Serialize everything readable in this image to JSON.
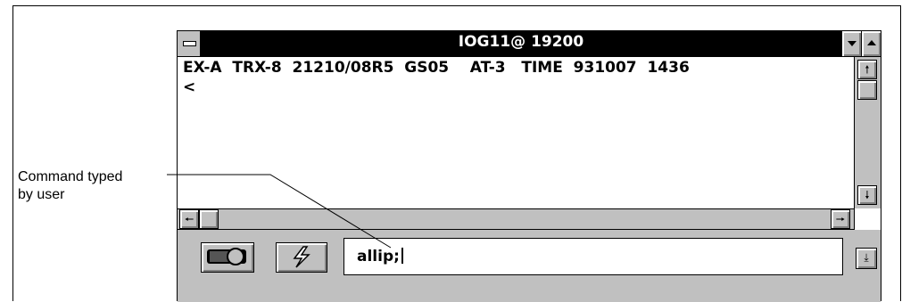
{
  "window": {
    "title": "IOG11@ 19200"
  },
  "output": {
    "lines": [
      "EX-A  TRX-8  21210/08R5  GS05    AT-3   TIME  931007  1436",
      "<"
    ]
  },
  "command_input": {
    "value": "allip;"
  },
  "annotation": {
    "line1": "Command typed",
    "line2": "by user"
  },
  "icons": {
    "system_menu": "system-menu-icon",
    "minimize": "minimize-icon",
    "maximize": "maximize-icon",
    "connect": "connect-toggle-icon",
    "break": "lightning-icon",
    "history": "history-down-icon"
  }
}
